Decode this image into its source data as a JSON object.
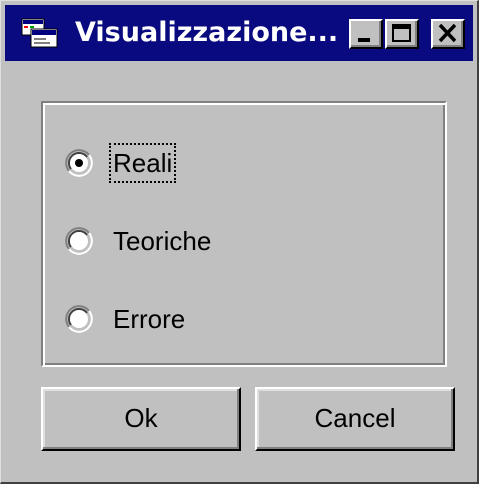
{
  "window": {
    "title": "Visualizzazione...",
    "title_bar_color": "#0a0a80",
    "face_color": "#c0c0c0",
    "icons": {
      "app": "app-window-icon",
      "minimize": "minimize-icon",
      "maximize": "maximize-icon",
      "close": "close-icon"
    }
  },
  "options": {
    "selected": "Reali",
    "items": [
      {
        "label": "Reali",
        "checked": true,
        "focused": true
      },
      {
        "label": "Teoriche",
        "checked": false,
        "focused": false
      },
      {
        "label": "Errore",
        "checked": false,
        "focused": false
      }
    ]
  },
  "buttons": {
    "ok_label": "Ok",
    "cancel_label": "Cancel"
  }
}
